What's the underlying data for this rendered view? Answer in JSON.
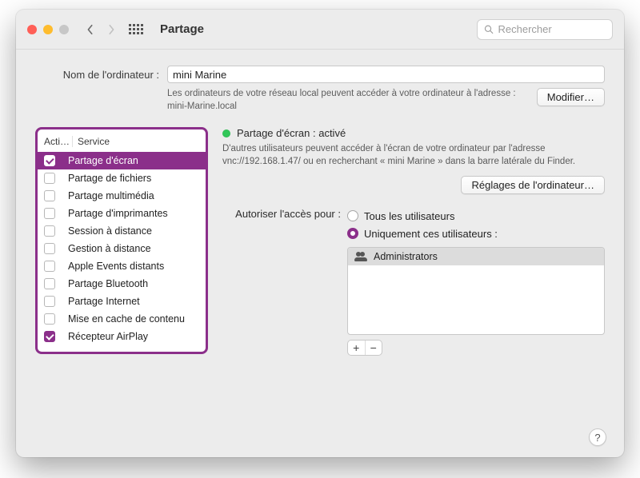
{
  "toolbar": {
    "title": "Partage",
    "search_placeholder": "Rechercher"
  },
  "computer_name": {
    "label": "Nom de l'ordinateur :",
    "value": "mini Marine",
    "description": "Les ordinateurs de votre réseau local peuvent accéder à votre ordinateur à l'adresse : mini-Marine.local",
    "modify_label": "Modifier…"
  },
  "services": {
    "col_active": "Acti…",
    "col_service": "Service",
    "items": [
      {
        "label": "Partage d'écran",
        "checked": true,
        "selected": true
      },
      {
        "label": "Partage de fichiers",
        "checked": false,
        "selected": false
      },
      {
        "label": "Partage multimédia",
        "checked": false,
        "selected": false
      },
      {
        "label": "Partage d'imprimantes",
        "checked": false,
        "selected": false
      },
      {
        "label": "Session à distance",
        "checked": false,
        "selected": false
      },
      {
        "label": "Gestion à distance",
        "checked": false,
        "selected": false
      },
      {
        "label": "Apple Events distants",
        "checked": false,
        "selected": false
      },
      {
        "label": "Partage Bluetooth",
        "checked": false,
        "selected": false
      },
      {
        "label": "Partage Internet",
        "checked": false,
        "selected": false
      },
      {
        "label": "Mise en cache de contenu",
        "checked": false,
        "selected": false
      },
      {
        "label": "Récepteur AirPlay",
        "checked": true,
        "selected": false
      }
    ]
  },
  "detail": {
    "status_title": "Partage d'écran : activé",
    "status_desc": "D'autres utilisateurs peuvent accéder à l'écran de votre ordinateur par l'adresse vnc://192.168.1.47/ ou en recherchant « mini Marine » dans la barre latérale du Finder.",
    "computer_settings_label": "Réglages de l'ordinateur…",
    "access_label": "Autoriser l'accès pour :",
    "radio_all": "Tous les utilisateurs",
    "radio_only": "Uniquement ces utilisateurs :",
    "users": [
      {
        "name": "Administrators"
      }
    ],
    "add_label": "+",
    "remove_label": "−",
    "help_label": "?"
  },
  "colors": {
    "accent": "#8b2f8a",
    "status_on": "#32c759"
  }
}
